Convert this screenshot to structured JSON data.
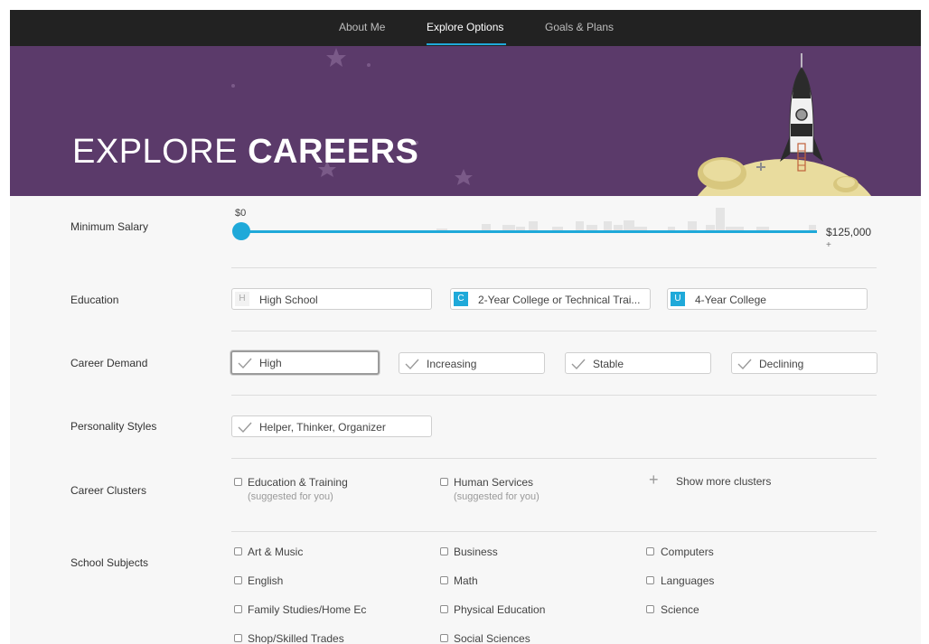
{
  "nav": {
    "items": [
      {
        "label": "About Me"
      },
      {
        "label": "Explore Options",
        "active": true
      },
      {
        "label": "Goals & Plans"
      }
    ]
  },
  "hero": {
    "title_light": "EXPLORE",
    "title_bold": "CAREERS"
  },
  "colors": {
    "hero_bg": "#5b3a6a",
    "accent": "#1fa9d9",
    "nav_bg": "#222222"
  },
  "filters": {
    "salary": {
      "label": "Minimum Salary",
      "min_label": "$0",
      "max_label": "$125,000",
      "max_suffix": "+",
      "value_fraction": 0
    },
    "education": {
      "label": "Education",
      "options": [
        {
          "letter": "H",
          "text": "High School",
          "selected": false
        },
        {
          "letter": "C",
          "text": "2-Year College or Technical Trai...",
          "selected": true
        },
        {
          "letter": "U",
          "text": "4-Year College",
          "selected": true
        }
      ]
    },
    "demand": {
      "label": "Career Demand",
      "options": [
        {
          "text": "High"
        },
        {
          "text": "Increasing"
        },
        {
          "text": "Stable"
        },
        {
          "text": "Declining"
        }
      ]
    },
    "personality": {
      "label": "Personality Styles",
      "value": "Helper, Thinker, Organizer"
    },
    "clusters": {
      "label": "Career Clusters",
      "items": [
        {
          "name": "Education & Training",
          "note": "(suggested for you)"
        },
        {
          "name": "Human Services",
          "note": "(suggested for you)"
        }
      ],
      "show_more": "Show more clusters"
    },
    "subjects": {
      "label": "School Subjects",
      "items": [
        "Art & Music",
        "Business",
        "Computers",
        "English",
        "Math",
        "Languages",
        "Family Studies/Home Ec",
        "Physical Education",
        "Science",
        "Shop/Skilled Trades",
        "Social Sciences"
      ]
    }
  }
}
